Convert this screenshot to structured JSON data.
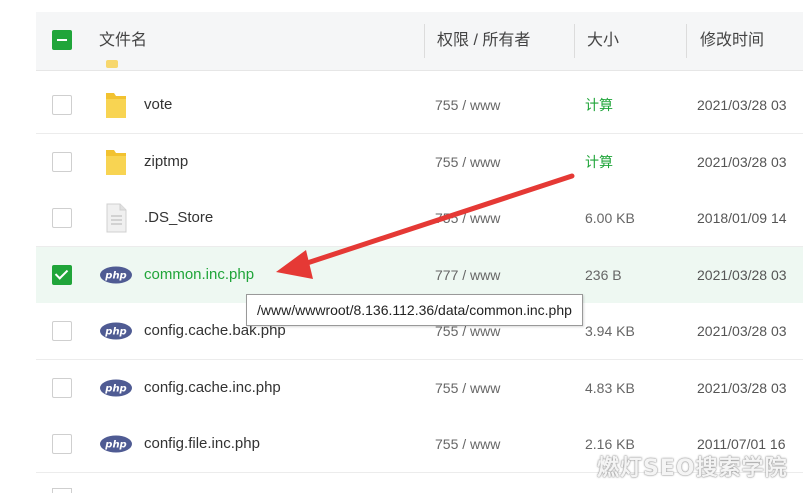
{
  "header": {
    "name_label": "文件名",
    "perm_label": "权限 / 所有者",
    "size_label": "大小",
    "mtime_label": "修改时间"
  },
  "rows": [
    {
      "icon": "folder-icon",
      "name": "vote",
      "perm": "755 / www",
      "size": "计算",
      "mtime": "2021/03/28 03",
      "checked": false
    },
    {
      "icon": "folder-icon",
      "name": "ziptmp",
      "perm": "755 / www",
      "size": "计算",
      "mtime": "2021/03/28 03",
      "checked": false
    },
    {
      "icon": "file-icon",
      "name": ".DS_Store",
      "perm": "755 / www",
      "size": "6.00 KB",
      "mtime": "2018/01/09 14",
      "checked": false
    },
    {
      "icon": "php-icon",
      "name": "common.inc.php",
      "perm": "777 / www",
      "size": "236 B",
      "mtime": "2021/03/28 03",
      "checked": true
    },
    {
      "icon": "php-icon",
      "name": "config.cache.bak.php",
      "perm": "755 / www",
      "size": "3.94 KB",
      "mtime": "2021/03/28 03",
      "checked": false
    },
    {
      "icon": "php-icon",
      "name": "config.cache.inc.php",
      "perm": "755 / www",
      "size": "4.83 KB",
      "mtime": "2021/03/28 03",
      "checked": false
    },
    {
      "icon": "php-icon",
      "name": "config.file.inc.php",
      "perm": "755 / www",
      "size": "2.16 KB",
      "mtime": "2011/07/01 16",
      "checked": false
    }
  ],
  "tooltip": "/www/wwwroot/8.136.112.36/data/common.inc.php",
  "watermark": "燃灯SEO搜索学院",
  "colors": {
    "accent": "#20a53a",
    "arrow": "#e53935"
  }
}
